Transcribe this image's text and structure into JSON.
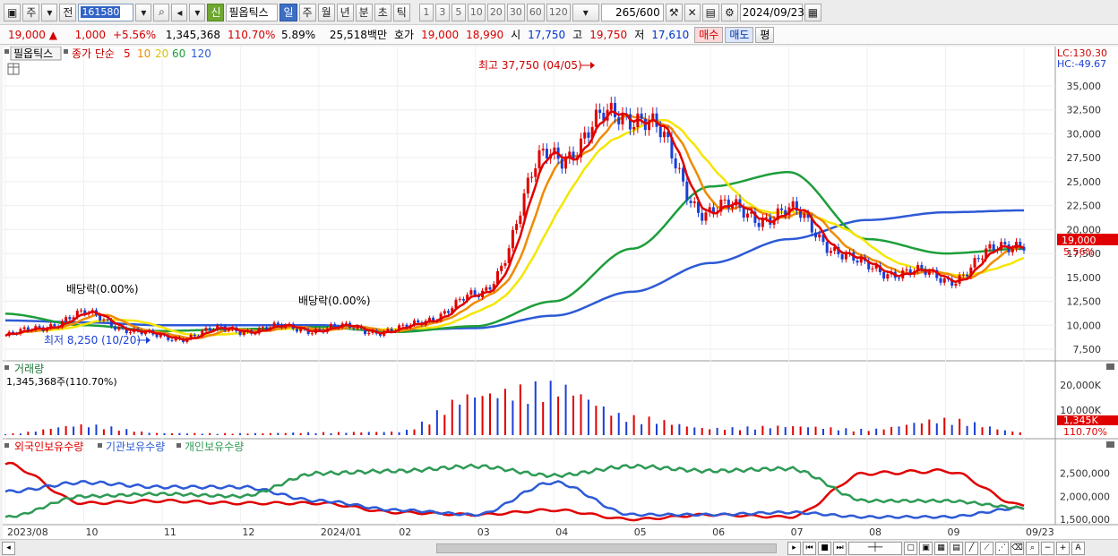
{
  "toolbar": {
    "tab_week": "주",
    "tab_prev": "전",
    "stock_code": "161580",
    "new_badge": "신",
    "stock_name": "필옵틱스",
    "periods": [
      "일",
      "주",
      "월",
      "년",
      "분",
      "초",
      "틱"
    ],
    "selected_period": "일",
    "intervals": [
      "1",
      "3",
      "5",
      "10",
      "20",
      "30",
      "60",
      "120"
    ],
    "count": "265/600",
    "date": "2024/09/23"
  },
  "quote": {
    "price": "19,000",
    "change": "1,000",
    "change_pct": "+5.56%",
    "volume": "1,345,368",
    "volume_ratio": "110.70%",
    "turnover": "5.89%",
    "amount": "25,518백만",
    "ask_label": "호가",
    "ask": "19,000",
    "bid": "18,990",
    "open_label": "시",
    "open": "17,750",
    "high_label": "고",
    "high": "19,750",
    "low_label": "저",
    "low": "17,610",
    "buy_button": "매수",
    "sell_button": "매도",
    "eval_button": "평"
  },
  "colors": {
    "up": "#e00000",
    "down": "#1a3fd6",
    "ma5": "#e00000",
    "ma10": "#f08a00",
    "ma20": "#f5e600",
    "ma60": "#1d9e3a",
    "ma120": "#2d5ad6",
    "foreign": "#e00000",
    "institution": "#2d5ad6",
    "individual": "#2e9a55"
  },
  "price_panel": {
    "title": "필옵틱스",
    "legend_prefix": "종가 단순",
    "ma_periods": [
      "5",
      "10",
      "20",
      "60",
      "120"
    ],
    "lc": "LC:130.30",
    "hc": "HC:-49.67",
    "y_ticks": [
      "35,000",
      "32,500",
      "30,000",
      "27,500",
      "25,000",
      "22,500",
      "20,000",
      "17,500",
      "15,000",
      "12,500",
      "10,000",
      "7,500"
    ],
    "current_price_tag": "19,000",
    "current_pct_tag": "5.56%",
    "annotation_high": "최고 37,750 (04/05)",
    "annotation_low": "최저 8,250 (10/20)",
    "dividend_1": "배당락(0.00%)",
    "dividend_2": "배당락(0.00%)"
  },
  "volume_panel": {
    "title": "거래량",
    "value": "1,345,368주(110.70%)",
    "y_ticks": [
      "20,000K",
      "10,000K"
    ],
    "tag_value": "1,345K",
    "tag_pct": "110.70%"
  },
  "holdings_panel": {
    "legend": [
      "외국인보유수량",
      "기관보유수량",
      "개인보유수량"
    ],
    "y_ticks": [
      "2,500,000",
      "2,000,000",
      "1,500,000"
    ]
  },
  "x_axis": [
    "2023/08",
    "10",
    "11",
    "12",
    "2024/01",
    "02",
    "03",
    "04",
    "05",
    "06",
    "07",
    "08",
    "09",
    "09/23"
  ],
  "chart_data": [
    {
      "type": "line",
      "title": "필옵틱스",
      "x": [
        "2023/08",
        "10",
        "11",
        "12",
        "2024/01",
        "02",
        "03",
        "04",
        "05",
        "06",
        "07",
        "08",
        "09",
        "09/23"
      ],
      "ylim": [
        7500,
        35000
      ],
      "series": [
        {
          "name": "종가",
          "values": [
            8900,
            11000,
            8700,
            9600,
            9700,
            9500,
            12800,
            28000,
            32500,
            22000,
            21500,
            16000,
            15000,
            19000
          ]
        },
        {
          "name": "60",
          "values": [
            11200,
            10000,
            9400,
            9600,
            9800,
            9300,
            9900,
            12500,
            18000,
            24500,
            26000,
            19000,
            17500,
            18000
          ]
        },
        {
          "name": "120",
          "values": [
            10500,
            10300,
            10000,
            10000,
            10000,
            9500,
            9700,
            11000,
            13500,
            16500,
            19000,
            21000,
            21800,
            22000
          ]
        }
      ]
    },
    {
      "type": "bar",
      "title": "거래량",
      "x": [
        "2023/08",
        "10",
        "11",
        "12",
        "2024/01",
        "02",
        "03",
        "04",
        "05",
        "06",
        "07",
        "08",
        "09",
        "09/23"
      ],
      "ylim": [
        0,
        25000
      ],
      "values": [
        600,
        4500,
        900,
        800,
        1200,
        1500,
        18000,
        22000,
        8000,
        3000,
        4000,
        2500,
        7000,
        1345
      ]
    },
    {
      "type": "line",
      "title": "보유수량",
      "x": [
        "2023/08",
        "10",
        "11",
        "12",
        "2024/01",
        "02",
        "03",
        "04",
        "05",
        "06",
        "07",
        "08",
        "09",
        "09/23"
      ],
      "ylim": [
        1500000,
        2900000
      ],
      "series": [
        {
          "name": "외국인보유수량",
          "values": [
            2700000,
            1850000,
            1900000,
            1850000,
            1850000,
            1650000,
            1600000,
            1700000,
            1500000,
            1600000,
            1550000,
            2500000,
            2550000,
            1800000
          ]
        },
        {
          "name": "기관보유수량",
          "values": [
            2100000,
            2300000,
            2200000,
            2200000,
            1900000,
            1700000,
            1600000,
            2300000,
            1600000,
            1600000,
            1650000,
            1550000,
            1550000,
            1750000
          ]
        },
        {
          "name": "개인보유수량",
          "values": [
            1550000,
            2000000,
            2050000,
            2000000,
            2500000,
            2550000,
            2650000,
            2450000,
            2650000,
            2550000,
            2600000,
            1900000,
            1900000,
            1750000
          ]
        }
      ]
    }
  ]
}
